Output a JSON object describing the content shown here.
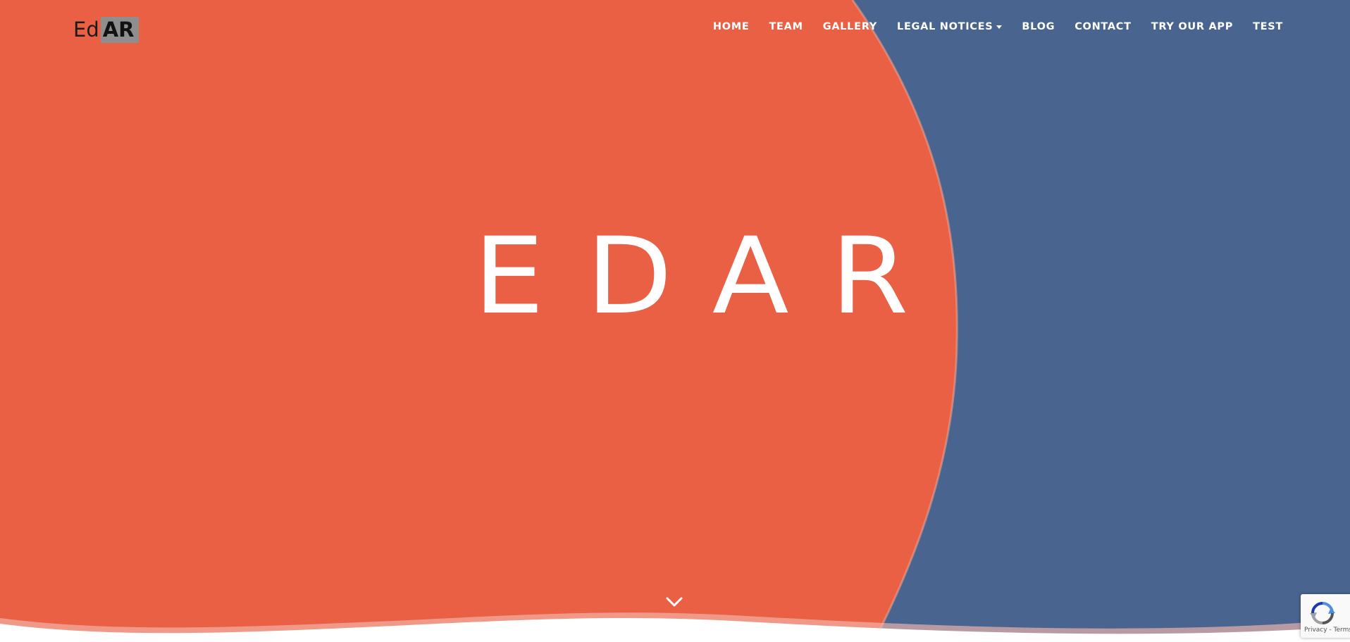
{
  "logo": {
    "left_text": "Ed",
    "right_text": "AR"
  },
  "nav": {
    "items": [
      {
        "label": "HOME"
      },
      {
        "label": "TEAM"
      },
      {
        "label": "GALLERY"
      },
      {
        "label": "LEGAL NOTICES"
      },
      {
        "label": "BLOG"
      },
      {
        "label": "CONTACT"
      },
      {
        "label": "TRY OUR APP"
      },
      {
        "label": "TEST"
      }
    ]
  },
  "hero": {
    "title": "EDAR"
  },
  "recaptcha": {
    "links": "Privacy - Terms"
  },
  "colors": {
    "coral": "#e96045",
    "blue": "#48648f",
    "white": "#ffffff"
  },
  "icons": {
    "scroll_down": "chevron-down-icon",
    "dropdown": "caret-down-icon",
    "recaptcha": "recaptcha-icon"
  }
}
